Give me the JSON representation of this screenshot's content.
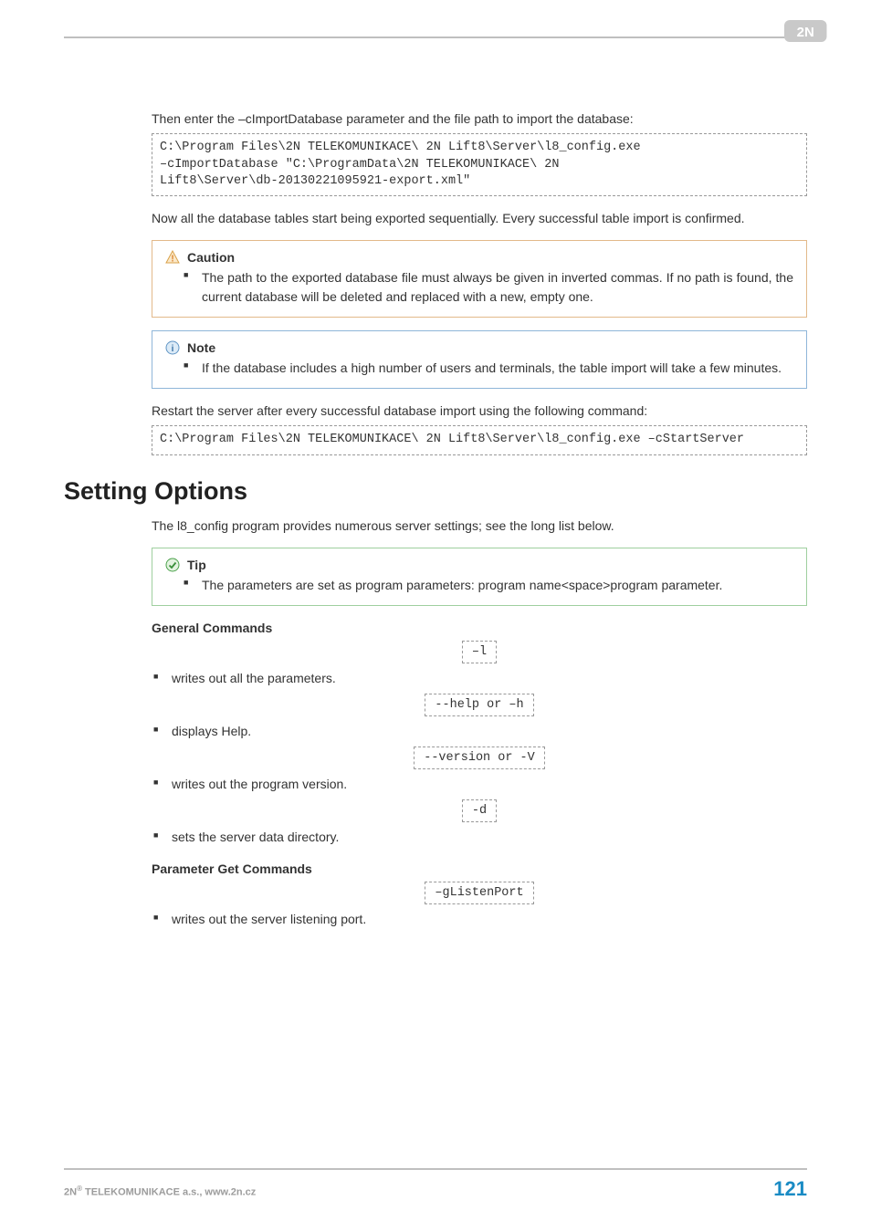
{
  "intro1": "Then enter the –cImportDatabase parameter and the file path to import the database:",
  "code1": "C:\\Program Files\\2N TELEKOMUNIKACE\\ 2N Lift8\\Server\\l8_config.exe\n–cImportDatabase \"C:\\ProgramData\\2N TELEKOMUNIKACE\\ 2N\nLift8\\Server\\db-20130221095921-export.xml\"",
  "para2": "Now all the database tables start being exported sequentially. Every successful table import is confirmed.",
  "caution": {
    "title": "Caution",
    "item": "The path to the exported database file must always be given in inverted commas. If no path is found, the current database will be deleted and replaced with a new, empty one."
  },
  "note": {
    "title": "Note",
    "item": "If the database includes a high number of users and terminals, the table import will take a few minutes."
  },
  "para3": "Restart the server after every successful database import using the following command:",
  "code2": "C:\\Program Files\\2N TELEKOMUNIKACE\\ 2N Lift8\\Server\\l8_config.exe –cStartServer",
  "h2": "Setting Options",
  "para4": "The l8_config program provides numerous server settings; see the long list below.",
  "tip": {
    "title": "Tip",
    "item": "The parameters are set as program parameters: program name<space>program parameter."
  },
  "general": {
    "heading": "General Commands",
    "c1": "–l",
    "d1": "writes out all the parameters.",
    "c2": "--help or –h",
    "d2": "displays Help.",
    "c3": "--version or -V",
    "d3": "writes out the program version.",
    "c4": "-d",
    "d4": "sets the server data directory."
  },
  "paramget": {
    "heading": "Parameter Get Commands",
    "c1": "–gListenPort",
    "d1": "writes out the server listening port."
  },
  "footer": {
    "left_prefix": "2N",
    "left_suffix": " TELEKOMUNIKACE a.s., www.2n.cz",
    "page": "121"
  }
}
